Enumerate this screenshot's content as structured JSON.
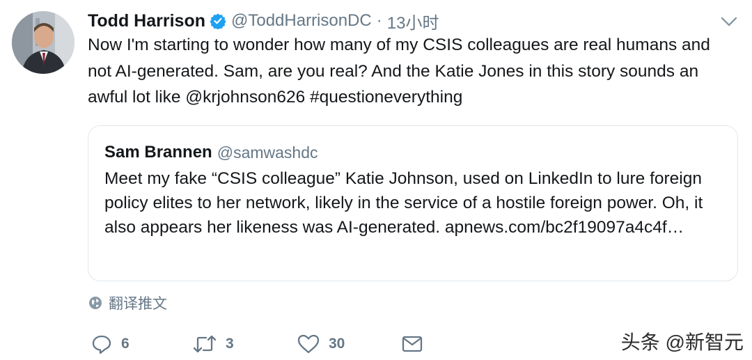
{
  "tweet": {
    "author_name": "Todd Harrison",
    "author_handle": "@ToddHarrisonDC",
    "separator": "·",
    "time": "13小时",
    "text": "Now I'm starting to wonder how many of my CSIS colleagues are real humans and not AI-generated. Sam, are you real? And the Katie Jones in this story sounds an awful lot like @krjohnson626 #questioneverything",
    "icons": {
      "verified": "verified-badge-icon",
      "menu": "chevron-down-icon",
      "avatar": "avatar"
    },
    "accent_color": "#1da1f2"
  },
  "quoted_tweet": {
    "author_name": "Sam Brannen",
    "author_handle": "@samwashdc",
    "text": "Meet my fake “CSIS colleague” Katie Johnson, used on LinkedIn to lure foreign policy elites to her network, likely in the service of a hostile foreign power. Oh, it also appears her likeness was AI-generated. apnews.com/bc2f19097a4c4f…"
  },
  "translate": {
    "label": "翻译推文",
    "icon": "globe-icon"
  },
  "actions": {
    "reply": {
      "icon": "reply-icon",
      "count": "6"
    },
    "retweet": {
      "icon": "retweet-icon",
      "count": "3"
    },
    "like": {
      "icon": "heart-icon",
      "count": "30"
    },
    "message": {
      "icon": "envelope-icon"
    }
  },
  "watermark": "头条 @新智元"
}
